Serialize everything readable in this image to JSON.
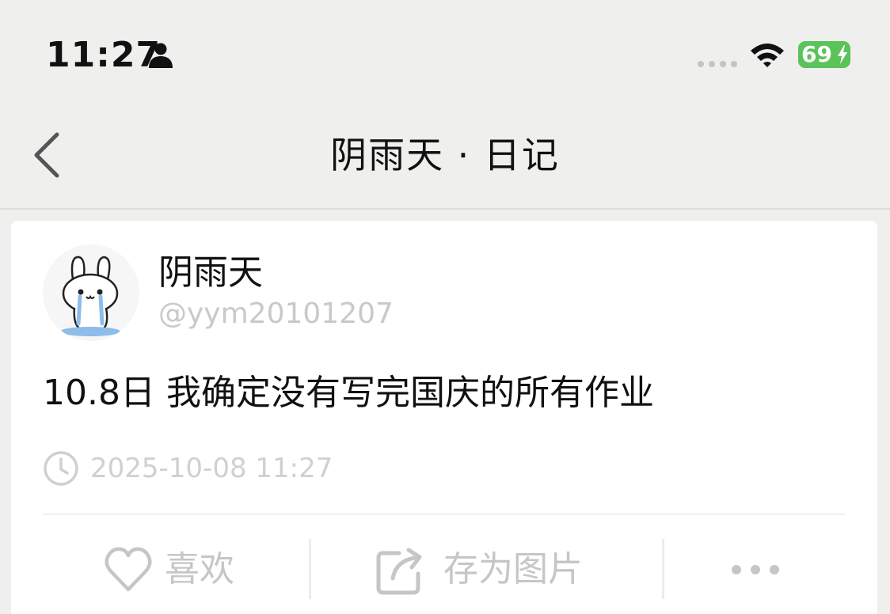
{
  "status_bar": {
    "time": "11:27",
    "battery_level": "69",
    "battery_color": "#5ac35a",
    "icons": [
      "person-icon",
      "signal-dots-icon",
      "wifi-icon",
      "battery-charging-icon"
    ]
  },
  "nav": {
    "back_icon": "chevron-left-icon",
    "title": "阴雨天 · 日记"
  },
  "post": {
    "author_name": "阴雨天",
    "author_handle": "@yym20101207",
    "content": "10.8日 我确定没有写完国庆的所有作业",
    "timestamp": "2025-10-08 11:27"
  },
  "actions": {
    "like_label": "喜欢",
    "save_label": "存为图片",
    "more_icon": "more-icon"
  },
  "colors": {
    "background": "#efefed",
    "card": "#ffffff",
    "muted_text": "#c6c6c6"
  }
}
